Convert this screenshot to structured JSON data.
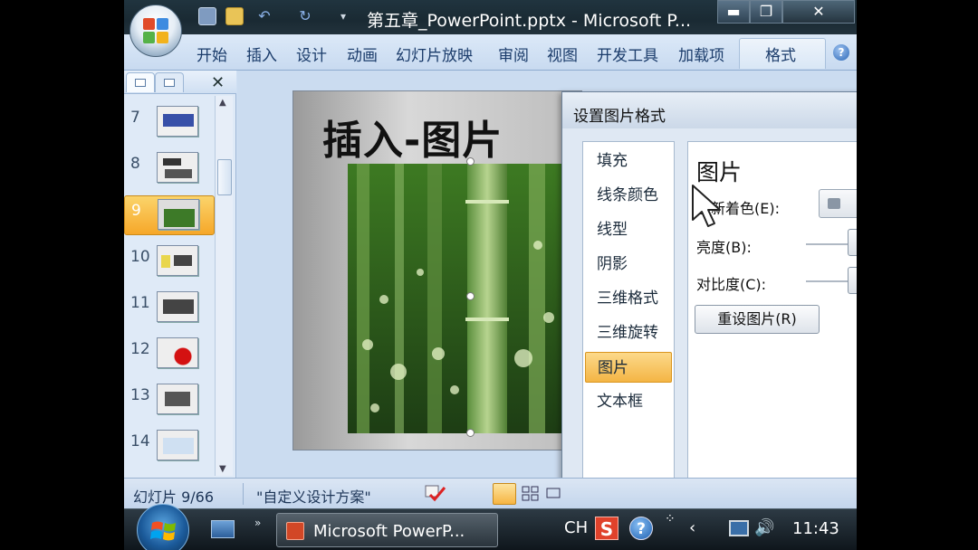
{
  "window": {
    "title": "第五章_PowerPoint.pptx - Microsoft P...",
    "minimize": "▬",
    "maximize": "❐",
    "close": "✕"
  },
  "ribbon": {
    "tabs": [
      "开始",
      "插入",
      "设计",
      "动画",
      "幻灯片放映",
      "审阅",
      "视图",
      "开发工具",
      "加载项"
    ],
    "contextual_tab": "格式"
  },
  "slides_pane": {
    "close": "✕",
    "thumbnails": [
      {
        "number": "7"
      },
      {
        "number": "8"
      },
      {
        "number": "9",
        "selected": true
      },
      {
        "number": "10"
      },
      {
        "number": "11"
      },
      {
        "number": "12"
      },
      {
        "number": "13"
      },
      {
        "number": "14"
      }
    ]
  },
  "slide": {
    "title": "插入-图片"
  },
  "dialog": {
    "title": "设置图片格式",
    "nav": [
      "填充",
      "线条颜色",
      "线型",
      "阴影",
      "三维格式",
      "三维旋转",
      "图片",
      "文本框"
    ],
    "selected_nav": "图片",
    "content": {
      "heading": "图片",
      "recolor_label": "重新着色(E):",
      "brightness_label": "亮度(B):",
      "contrast_label": "对比度(C):",
      "reset_button": "重设图片(R)"
    }
  },
  "status_bar": {
    "slide_info": "幻灯片 9/66",
    "theme": "\"自定义设计方案\""
  },
  "taskbar": {
    "app": "Microsoft PowerP...",
    "lang": "CH",
    "ime": "S",
    "help": "?",
    "clock": "11:43"
  },
  "colors": {
    "accent_selected": "#f6a729",
    "office_blue": "#1b3c6b"
  }
}
